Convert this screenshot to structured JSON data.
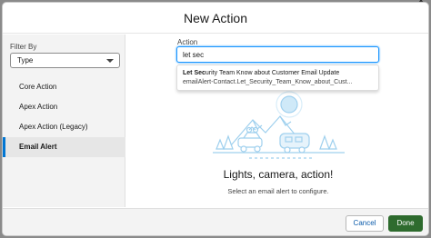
{
  "modal": {
    "title": "New Action"
  },
  "sidebar": {
    "filter_label": "Filter By",
    "filter_value": "Type",
    "items": [
      {
        "label": "Core Action",
        "active": false
      },
      {
        "label": "Apex Action",
        "active": false
      },
      {
        "label": "Apex Action (Legacy)",
        "active": false
      },
      {
        "label": "Email Alert",
        "active": true
      }
    ]
  },
  "action_field": {
    "label": "Action",
    "value": "let sec"
  },
  "suggestion": {
    "title_match": "Let Sec",
    "title_rest": "urity Team Know about Customer Email Update",
    "subtitle": "emailAlert-Contact.Let_Security_Team_Know_about_Cust..."
  },
  "empty_state": {
    "title": "Lights, camera, action!",
    "subtitle": "Select an email alert to configure."
  },
  "footer": {
    "cancel_label": "Cancel",
    "done_label": "Done"
  },
  "colors": {
    "accent_blue": "#0176d3",
    "done_green": "#2e6b2e",
    "illustration_blue": "#9fd0ee"
  }
}
